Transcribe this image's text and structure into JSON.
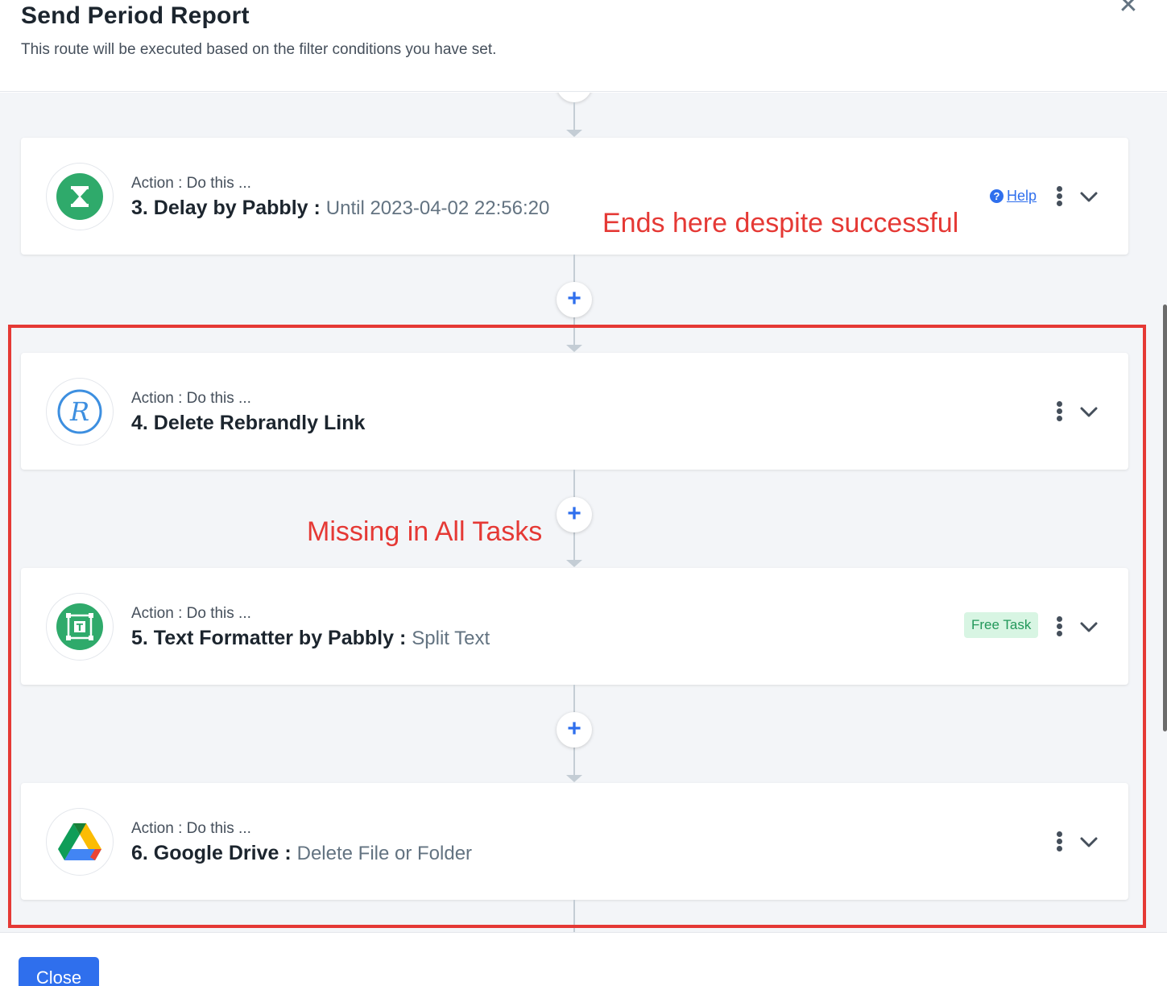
{
  "modal": {
    "title": "Send Period Report",
    "subtitle": "This route will be executed based on the filter conditions you have set.",
    "close_glyph": "✕"
  },
  "steps": [
    {
      "kicker": "Action : Do this ...",
      "title": "3. Delay by Pabbly :",
      "sub": "Until 2023-04-02 22:56:20",
      "icon": "hourglass-icon",
      "icon_color": "#2faa6b",
      "help_label": "Help"
    },
    {
      "kicker": "Action : Do this ...",
      "title": "4. Delete Rebrandly Link",
      "sub": "",
      "icon": "rebrandly-icon",
      "icon_color": "#3d8fe0"
    },
    {
      "kicker": "Action : Do this ...",
      "title": "5. Text Formatter by Pabbly :",
      "sub": "Split Text",
      "icon": "text-formatter-icon",
      "icon_color": "#2faa6b",
      "badge": "Free Task"
    },
    {
      "kicker": "Action : Do this ...",
      "title": "6. Google Drive :",
      "sub": "Delete File or Folder",
      "icon": "google-drive-icon"
    }
  ],
  "add_step_glyph": "+",
  "annotations": {
    "ends_here": "Ends here despite successful",
    "missing": "Missing in All Tasks",
    "color": "#e53935"
  },
  "footer": {
    "close_label": "Close"
  },
  "colors": {
    "accent": "#2f6fed",
    "canvas_bg": "#f3f5f8",
    "badge_bg": "#d8f5e3",
    "badge_text": "#22985a"
  }
}
